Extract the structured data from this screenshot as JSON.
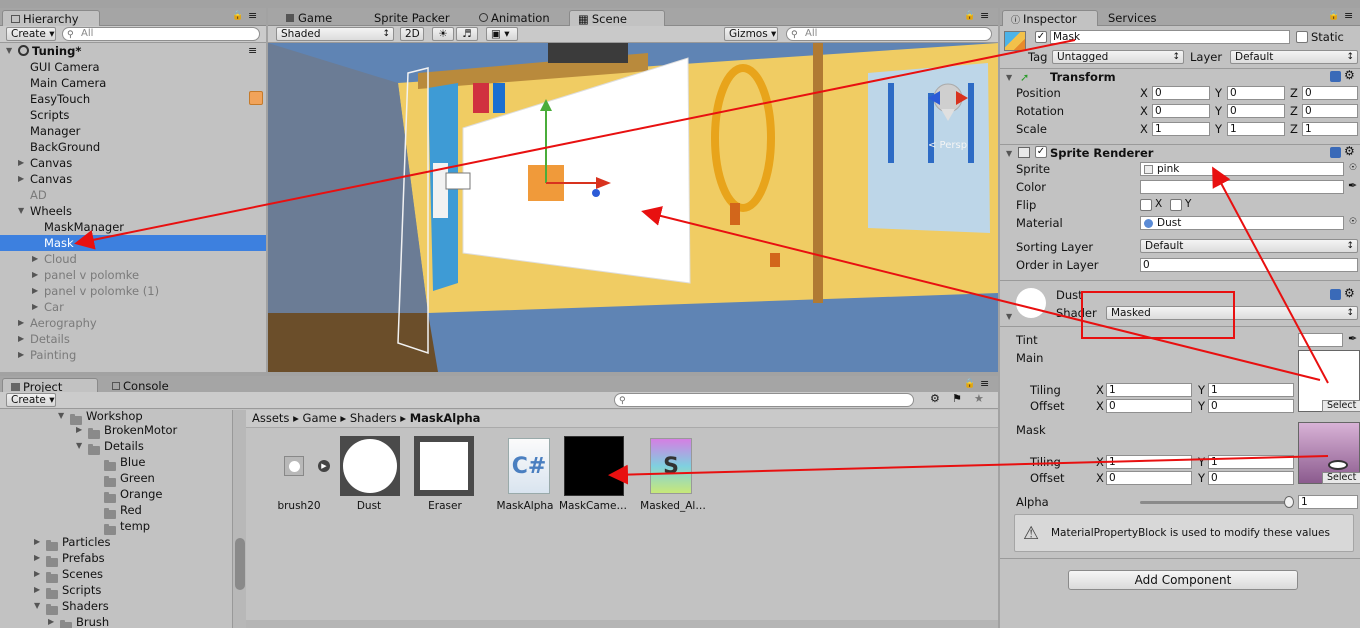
{
  "hierarchy": {
    "tab": "Hierarchy",
    "create": "Create",
    "search_placeholder": "All",
    "scene": "Tuning*",
    "rows": [
      {
        "label": "GUI Camera"
      },
      {
        "label": "Main Camera"
      },
      {
        "label": "EasyTouch"
      },
      {
        "label": "Scripts"
      },
      {
        "label": "Manager"
      },
      {
        "label": "BackGround"
      },
      {
        "label": "Canvas"
      },
      {
        "label": "Canvas"
      },
      {
        "label": "AD"
      },
      {
        "label": "Wheels"
      },
      {
        "label": "MaskManager"
      },
      {
        "label": "Mask"
      },
      {
        "label": "Cloud"
      },
      {
        "label": "panel v polomke"
      },
      {
        "label": "panel v polomke (1)"
      },
      {
        "label": "Car"
      },
      {
        "label": "Aerography"
      },
      {
        "label": "Details"
      },
      {
        "label": "Painting"
      }
    ]
  },
  "scene_view": {
    "tabs": [
      "Game",
      "Sprite Packer",
      "Animation",
      "Scene"
    ],
    "shading": "Shaded",
    "mode_2d": "2D",
    "gizmos": "Gizmos",
    "search_placeholder": "All",
    "persp_label": "< Persp"
  },
  "project": {
    "tabs": [
      "Project",
      "Console"
    ],
    "create": "Create",
    "tree": [
      "Workshop",
      "BrokenMotor",
      "Details",
      "Blue",
      "Green",
      "Orange",
      "Red",
      "temp",
      "Particles",
      "Prefabs",
      "Scenes",
      "Scripts",
      "Shaders",
      "Brush"
    ],
    "breadcrumb": [
      "Assets",
      "Game",
      "Shaders",
      "MaskAlpha"
    ],
    "assets": [
      {
        "name": "brush20",
        "kind": "small-circle"
      },
      {
        "name": "Dust",
        "kind": "material-white-circle"
      },
      {
        "name": "Eraser",
        "kind": "material-white-square"
      },
      {
        "name": "MaskAlpha",
        "kind": "csharp-script"
      },
      {
        "name": "MaskCame…",
        "kind": "render-texture-black"
      },
      {
        "name": "Masked_Al…",
        "kind": "shader"
      }
    ]
  },
  "inspector": {
    "tabs": [
      "Inspector",
      "Services"
    ],
    "object_name": "Mask",
    "static_label": "Static",
    "tag_label": "Tag",
    "tag_value": "Untagged",
    "layer_label": "Layer",
    "layer_value": "Default",
    "transform": {
      "title": "Transform",
      "rows": [
        {
          "label": "Position",
          "x": "0",
          "y": "0",
          "z": "0"
        },
        {
          "label": "Rotation",
          "x": "0",
          "y": "0",
          "z": "0"
        },
        {
          "label": "Scale",
          "x": "1",
          "y": "1",
          "z": "1"
        }
      ]
    },
    "sprite_renderer": {
      "title": "Sprite Renderer",
      "sprite_label": "Sprite",
      "sprite_value": "pink",
      "color_label": "Color",
      "flip_label": "Flip",
      "flip_x": "X",
      "flip_y": "Y",
      "material_label": "Material",
      "material_value": "Dust",
      "sorting_layer_label": "Sorting Layer",
      "sorting_layer_value": "Default",
      "order_label": "Order in Layer",
      "order_value": "0"
    },
    "material": {
      "name": "Dust",
      "shader_label": "Shader",
      "shader_value": "Masked",
      "tint_label": "Tint",
      "main_label": "Main",
      "tiling_label": "Tiling",
      "offset_label": "Offset",
      "main_tiling": {
        "x": "1",
        "y": "1"
      },
      "main_offset": {
        "x": "0",
        "y": "0"
      },
      "mask_label": "Mask",
      "mask_tiling": {
        "x": "1",
        "y": "1"
      },
      "mask_offset": {
        "x": "0",
        "y": "0"
      },
      "select_label": "Select",
      "alpha_label": "Alpha",
      "alpha_value": "1",
      "info_text": "MaterialPropertyBlock is used to modify these values"
    },
    "add_component": "Add Component"
  },
  "axis_letters": {
    "x": "X",
    "y": "Y",
    "z": "Z"
  },
  "colors": {
    "selection": "#3d80df",
    "annotation_arrow": "#e81010",
    "panel_bg": "#c2c2c2"
  }
}
